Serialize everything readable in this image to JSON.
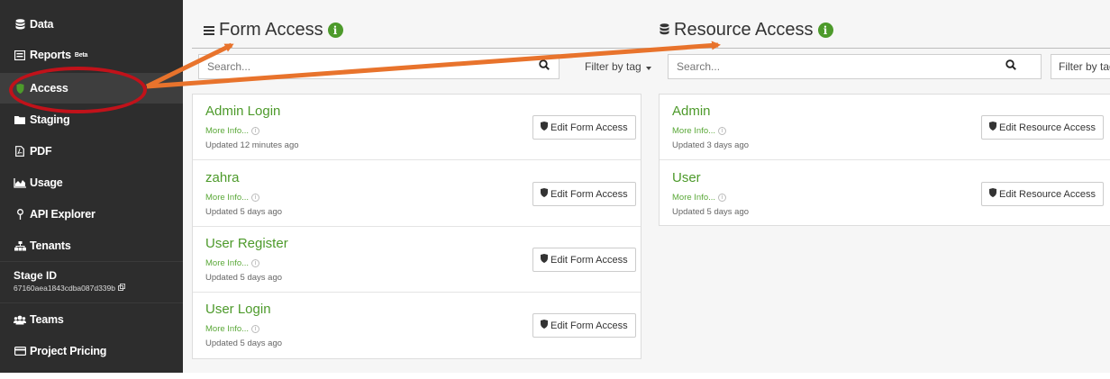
{
  "sidebar": {
    "items": [
      {
        "label": "Data",
        "icon": "database-icon"
      },
      {
        "label": "Reports",
        "badge": "Beta",
        "icon": "report-icon"
      },
      {
        "label": "Access",
        "icon": "shield-icon"
      },
      {
        "label": "Staging",
        "icon": "folder-icon"
      },
      {
        "label": "PDF",
        "icon": "pdf-icon"
      },
      {
        "label": "Usage",
        "icon": "area-chart-icon"
      },
      {
        "label": "API Explorer",
        "icon": "map-pin-icon"
      },
      {
        "label": "Tenants",
        "icon": "sitemap-icon"
      },
      {
        "label": "Teams",
        "icon": "users-icon"
      },
      {
        "label": "Project Pricing",
        "icon": "credit-card-icon"
      }
    ],
    "stage": {
      "title": "Stage ID",
      "id": "67160aea1843cdba087d339b"
    }
  },
  "form_access": {
    "title": "Form Access",
    "search_placeholder": "Search...",
    "filter_label": "Filter by tag",
    "items": [
      {
        "title": "Admin Login",
        "more": "More Info...",
        "updated": "Updated 12 minutes ago",
        "button": "Edit Form Access"
      },
      {
        "title": "zahra",
        "more": "More Info...",
        "updated": "Updated 5 days ago",
        "button": "Edit Form Access"
      },
      {
        "title": "User Register",
        "more": "More Info...",
        "updated": "Updated 5 days ago",
        "button": "Edit Form Access"
      },
      {
        "title": "User Login",
        "more": "More Info...",
        "updated": "Updated 5 days ago",
        "button": "Edit Form Access"
      }
    ]
  },
  "resource_access": {
    "title": "Resource Access",
    "search_placeholder": "Search...",
    "filter_label": "Filter by tag",
    "items": [
      {
        "title": "Admin",
        "more": "More Info...",
        "updated": "Updated 3 days ago",
        "button": "Edit Resource Access"
      },
      {
        "title": "User",
        "more": "More Info...",
        "updated": "Updated 5 days ago",
        "button": "Edit Resource Access"
      }
    ]
  },
  "colors": {
    "sidebar_bg": "#2d2d2d",
    "accent_green": "#4d9a2b",
    "highlight_red": "#c1121a",
    "arrow_orange": "#e8732c"
  }
}
